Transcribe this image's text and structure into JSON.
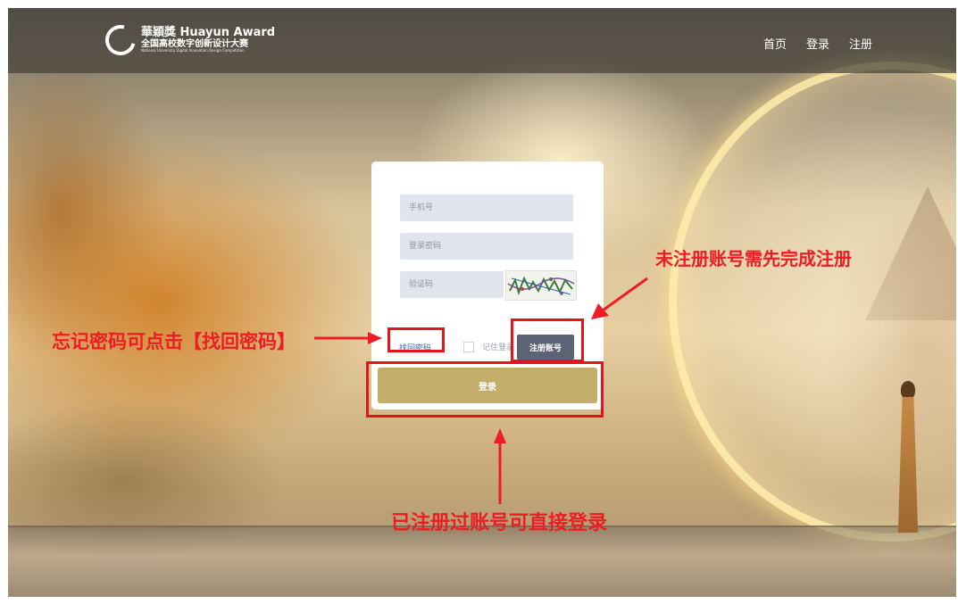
{
  "header": {
    "logo_line1": "華穎獎 Huayun Award",
    "logo_line2": "全国高校数字创新设计大赛",
    "logo_line3": "National University Digital Innovation Design Competition",
    "nav": [
      "首页",
      "登录",
      "注册"
    ]
  },
  "login": {
    "phone_placeholder": "手机号",
    "password_placeholder": "登录密码",
    "captcha_placeholder": "验证码",
    "forgot_label": "找回密码",
    "remember_label": "记住登录",
    "register_label": "注册账号",
    "login_label": "登录"
  },
  "annotations": {
    "forgot": "忘记密码可点击【找回密码】",
    "register": "未注册账号需先完成注册",
    "login": "已注册过账号可直接登录"
  },
  "colors": {
    "annotation": "#ee1c24",
    "login_button": "#c3ad6b",
    "register_button": "#5a6475",
    "input_bg": "#dfe4ee"
  }
}
